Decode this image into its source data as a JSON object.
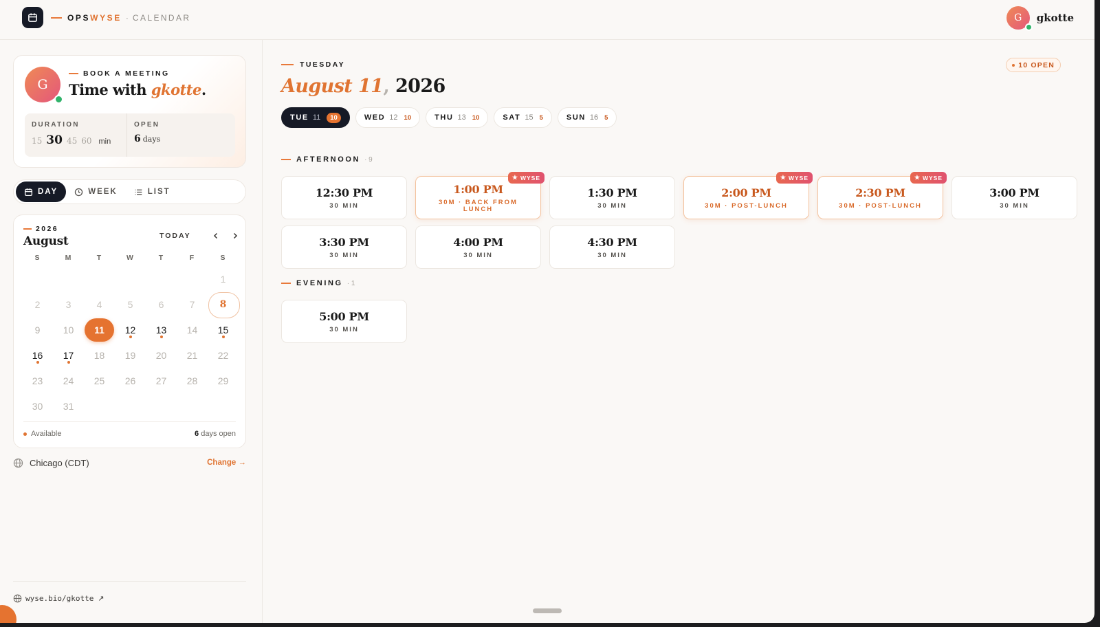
{
  "header": {
    "brand_ops": "OPS",
    "brand_wyse": "WYSE",
    "brand_sep": "·",
    "brand_section": "CALENDAR",
    "user_initial": "G",
    "user_name": "gkotte"
  },
  "booking": {
    "avatar_initial": "G",
    "eyebrow": "BOOK A MEETING",
    "title_prefix": "Time with ",
    "title_name": "gkotte",
    "title_suffix": ".",
    "duration_label": "DURATION",
    "durations": [
      "15",
      "30",
      "45",
      "60"
    ],
    "selected_duration": "30",
    "duration_unit": "min",
    "open_label": "OPEN",
    "open_value": "6",
    "open_unit": "days"
  },
  "views": {
    "day": "DAY",
    "week": "WEEK",
    "list": "LIST",
    "active": "day"
  },
  "calendar": {
    "year": "2026",
    "month": "August",
    "today_label": "TODAY",
    "weekdays": [
      "S",
      "M",
      "T",
      "W",
      "T",
      "F",
      "S"
    ],
    "leading_blanks": 6,
    "days_in_month": 31,
    "selected_day": 11,
    "ring_day": 8,
    "available_days": [
      12,
      13,
      15,
      16,
      17
    ],
    "past_days": [
      1,
      2,
      3,
      4,
      5,
      6,
      7
    ],
    "legend_available": "Available",
    "days_open_num": "6",
    "days_open_text": " days open",
    "accent_color": "#e57330"
  },
  "timezone": {
    "label": "Chicago (CDT)",
    "change": "Change →"
  },
  "footer": {
    "link": "wyse.bio/gkotte",
    "link_arrow": "↗"
  },
  "main": {
    "weekday": "TUESDAY",
    "date_month_day": "August 11",
    "date_comma": ",",
    "date_year": " 2026",
    "open_badge": "10 OPEN",
    "day_tabs": [
      {
        "name": "TUE",
        "num": "11",
        "count": "10",
        "active": true
      },
      {
        "name": "WED",
        "num": "12",
        "count": "10",
        "active": false
      },
      {
        "name": "THU",
        "num": "13",
        "count": "10",
        "active": false
      },
      {
        "name": "SAT",
        "num": "15",
        "count": "5",
        "active": false
      },
      {
        "name": "SUN",
        "num": "16",
        "count": "5",
        "active": false
      }
    ],
    "afternoon_label": "AFTERNOON",
    "afternoon_count": "· 9",
    "evening_label": "EVENING",
    "evening_count": "· 1",
    "wyse_tag": "WYSE",
    "afternoon_slots": [
      {
        "time": "12:30 PM",
        "sub": "30 MIN",
        "featured": false
      },
      {
        "time": "1:00 PM",
        "sub": "30M · BACK FROM LUNCH",
        "featured": true
      },
      {
        "time": "1:30 PM",
        "sub": "30 MIN",
        "featured": false
      },
      {
        "time": "2:00 PM",
        "sub": "30M · POST-LUNCH",
        "featured": true
      },
      {
        "time": "2:30 PM",
        "sub": "30M · POST-LUNCH",
        "featured": true
      },
      {
        "time": "3:00 PM",
        "sub": "30 MIN",
        "featured": false
      },
      {
        "time": "3:30 PM",
        "sub": "30 MIN",
        "featured": false
      },
      {
        "time": "4:00 PM",
        "sub": "30 MIN",
        "featured": false
      },
      {
        "time": "4:30 PM",
        "sub": "30 MIN",
        "featured": false
      }
    ],
    "evening_slots": [
      {
        "time": "5:00 PM",
        "sub": "30 MIN",
        "featured": false
      }
    ]
  }
}
